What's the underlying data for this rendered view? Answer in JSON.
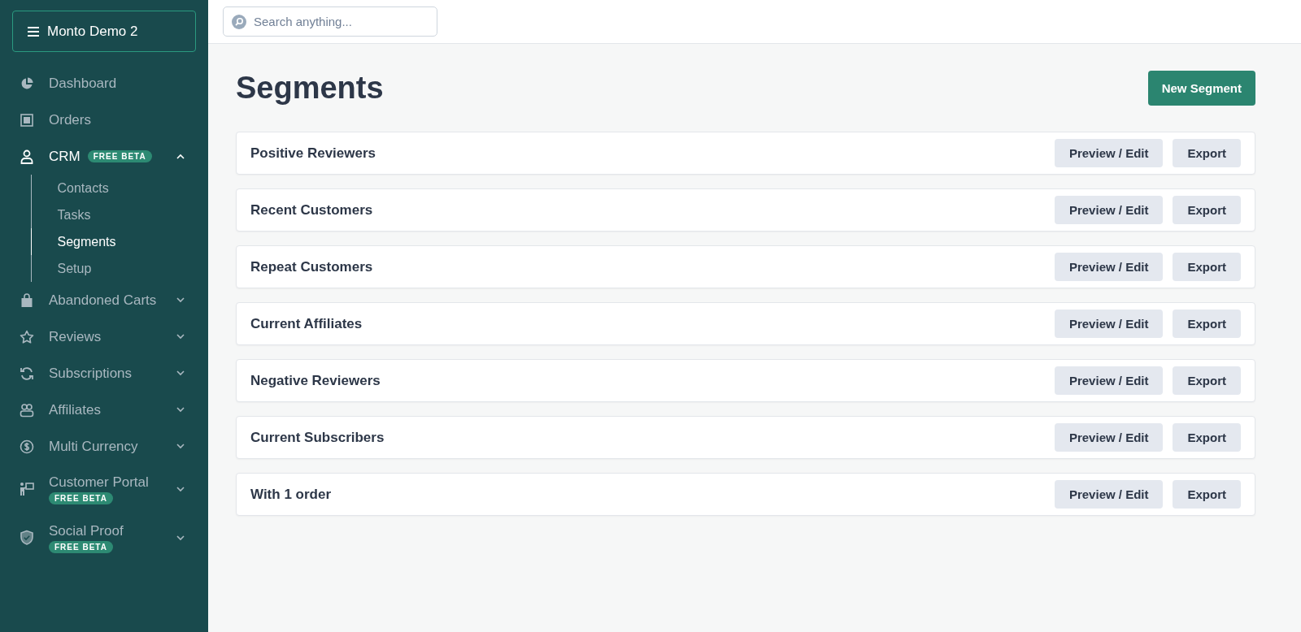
{
  "workspace": {
    "label": "Monto Demo 2"
  },
  "nav": [
    {
      "label": "Dashboard",
      "selected": false
    },
    {
      "label": "Orders",
      "selected": false
    },
    {
      "label": "CRM",
      "badge": "FREE BETA",
      "selected": true,
      "expanded": true,
      "children": [
        {
          "label": "Contacts",
          "selected": false
        },
        {
          "label": "Tasks",
          "selected": false
        },
        {
          "label": "Segments",
          "selected": true
        },
        {
          "label": "Setup",
          "selected": false
        }
      ]
    },
    {
      "label": "Abandoned Carts",
      "selected": false,
      "expanded": false
    },
    {
      "label": "Reviews",
      "selected": false,
      "expanded": false
    },
    {
      "label": "Subscriptions",
      "selected": false,
      "expanded": false
    },
    {
      "label": "Affiliates",
      "selected": false,
      "expanded": false
    },
    {
      "label": "Multi Currency",
      "selected": false,
      "expanded": false
    },
    {
      "label": "Customer Portal",
      "badge": "FREE BETA",
      "selected": false,
      "expanded": false
    },
    {
      "label": "Social Proof",
      "badge": "FREE BETA",
      "selected": false,
      "expanded": false
    }
  ],
  "search": {
    "placeholder": "Search anything..."
  },
  "page": {
    "title": "Segments",
    "action": "New Segment"
  },
  "segments": [
    {
      "name": "Positive Reviewers",
      "actions": [
        "Preview / Edit",
        "Export"
      ]
    },
    {
      "name": "Recent Customers",
      "actions": [
        "Preview / Edit",
        "Export"
      ]
    },
    {
      "name": "Repeat Customers",
      "actions": [
        "Preview / Edit",
        "Export"
      ]
    },
    {
      "name": "Current Affiliates",
      "actions": [
        "Preview / Edit",
        "Export"
      ]
    },
    {
      "name": "Negative Reviewers",
      "actions": [
        "Preview / Edit",
        "Export"
      ]
    },
    {
      "name": "Current Subscribers",
      "actions": [
        "Preview / Edit",
        "Export"
      ]
    },
    {
      "name": "With 1 order",
      "actions": [
        "Preview / Edit",
        "Export"
      ]
    }
  ]
}
